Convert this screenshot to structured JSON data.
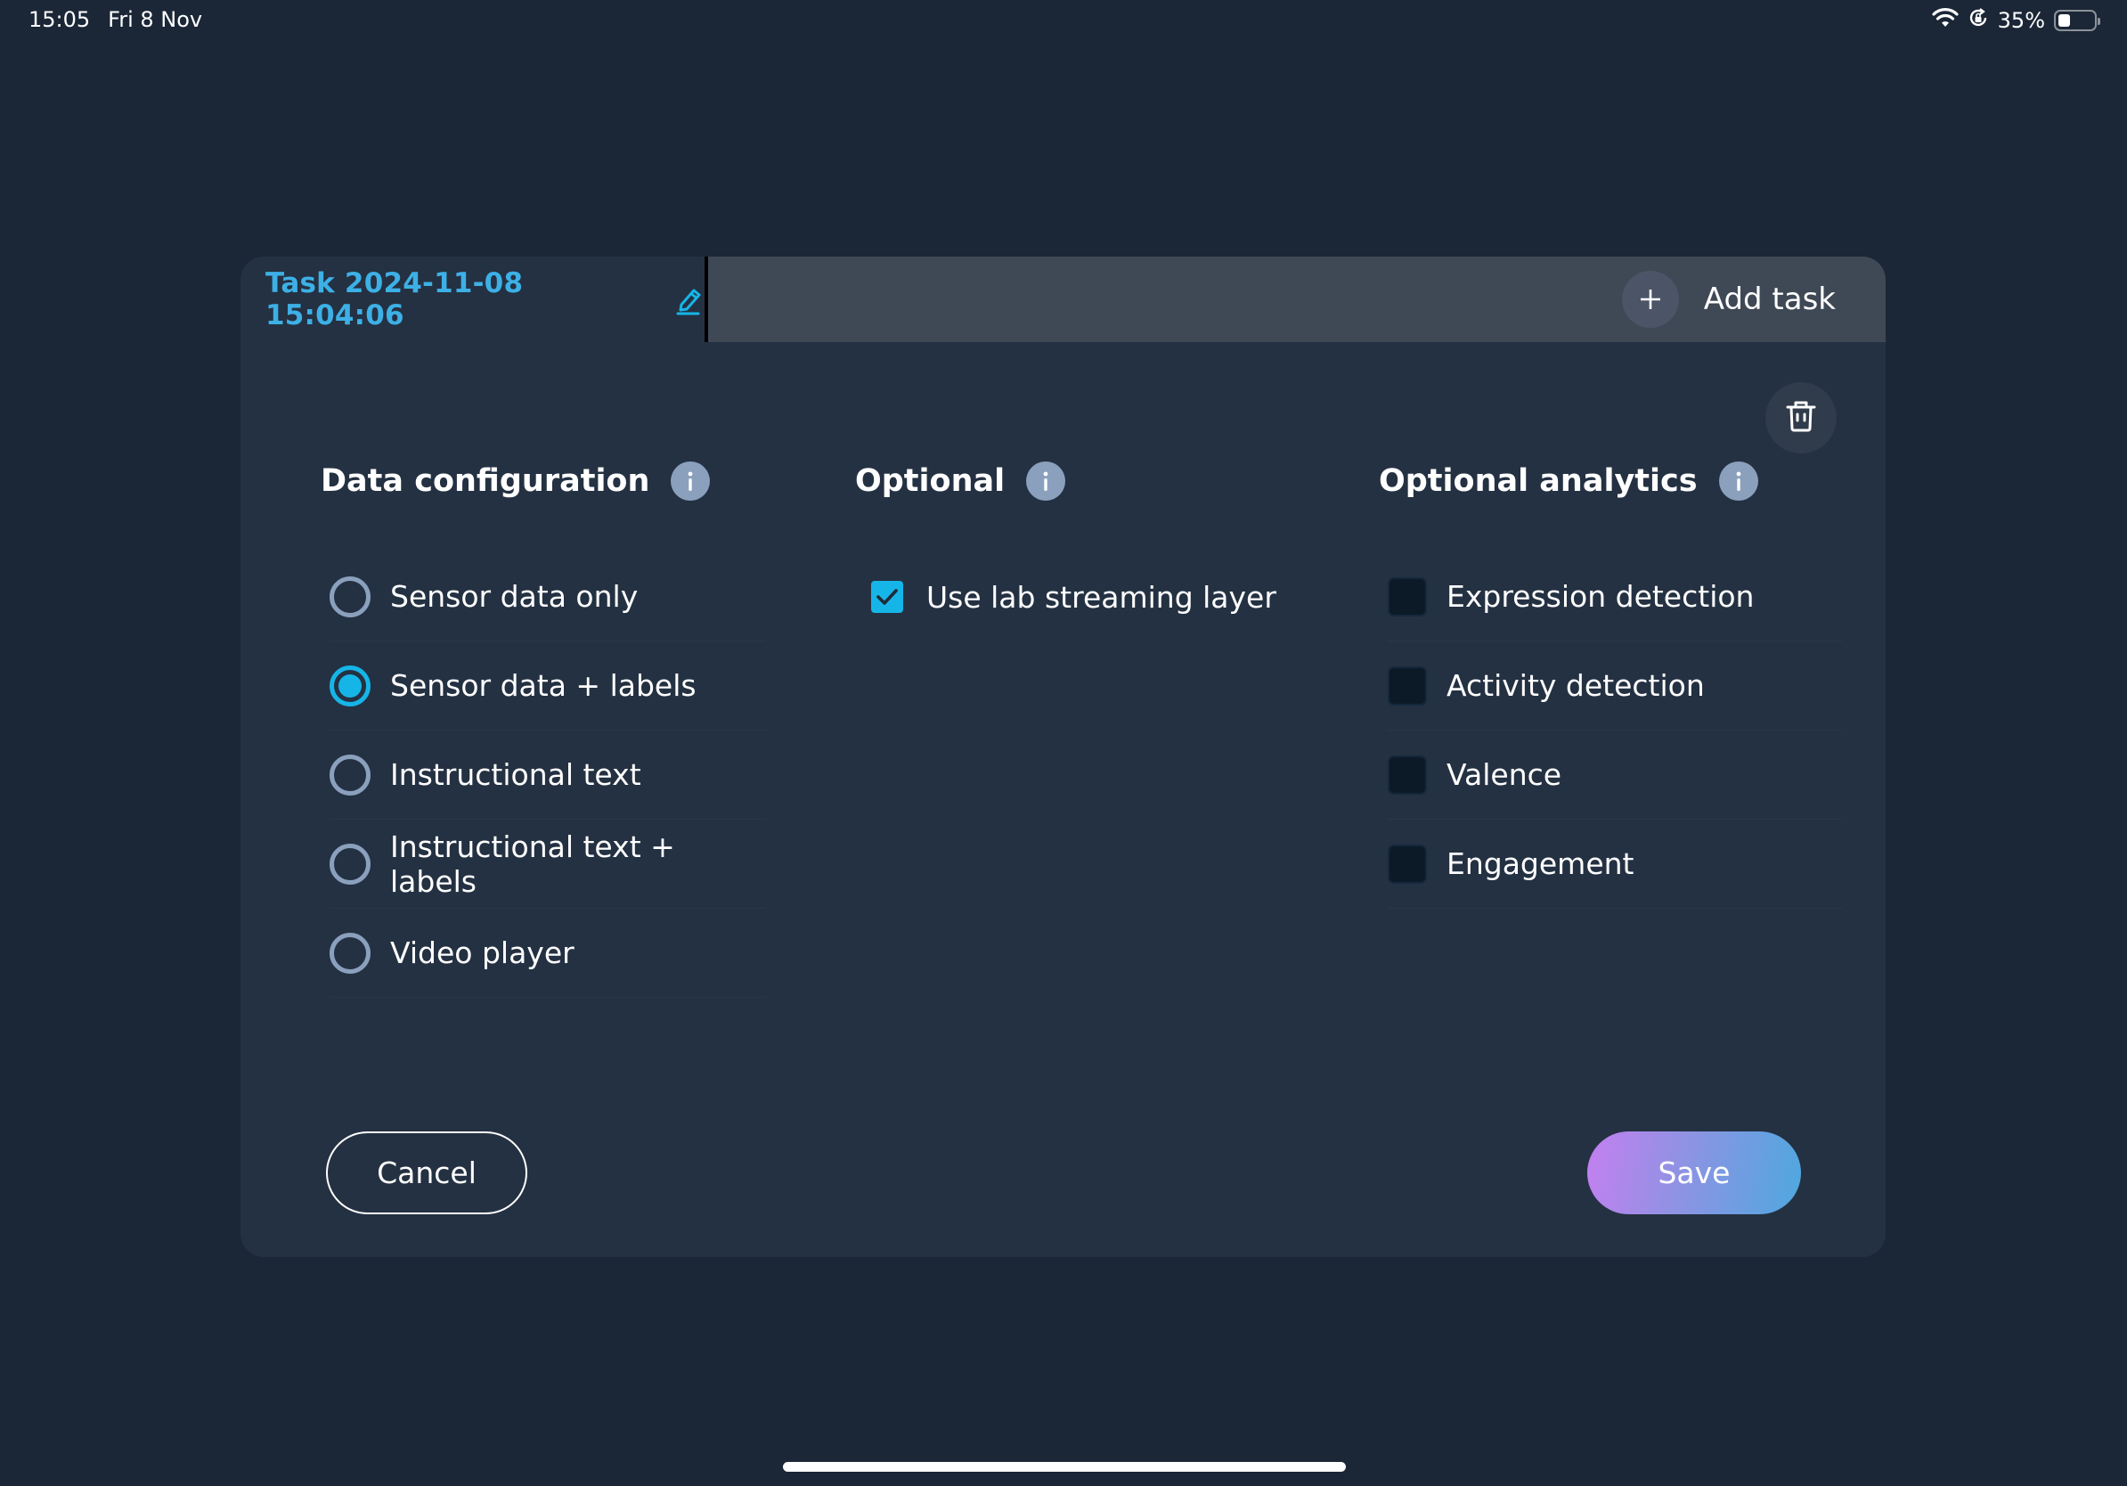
{
  "status_bar": {
    "time": "15:05",
    "date": "Fri 8 Nov",
    "battery_percent": "35%",
    "battery_level": 0.35,
    "icons": [
      "wifi-icon",
      "orientation-lock-icon",
      "battery-icon"
    ]
  },
  "tabs": {
    "active_title": "Task 2024-11-08 15:04:06",
    "edit_icon": "pencil-icon",
    "add_task_label": "Add task",
    "add_icon": "plus-icon"
  },
  "actions": {
    "delete_icon": "trash-icon"
  },
  "sections": {
    "data_configuration": {
      "title": "Data configuration",
      "type": "radio",
      "selected": "Sensor data + labels",
      "options": [
        {
          "label": "Sensor data only",
          "checked": false
        },
        {
          "label": "Sensor data + labels",
          "checked": true
        },
        {
          "label": "Instructional text",
          "checked": false
        },
        {
          "label": "Instructional text + labels",
          "checked": false
        },
        {
          "label": "Video player",
          "checked": false
        }
      ]
    },
    "optional": {
      "title": "Optional",
      "type": "checkbox",
      "options": [
        {
          "label": "Use lab streaming layer",
          "checked": true
        }
      ]
    },
    "optional_analytics": {
      "title": "Optional analytics",
      "type": "checkbox",
      "options": [
        {
          "label": "Expression detection",
          "checked": false
        },
        {
          "label": "Activity detection",
          "checked": false
        },
        {
          "label": "Valence",
          "checked": false
        },
        {
          "label": "Engagement",
          "checked": false
        }
      ]
    }
  },
  "footer": {
    "cancel_label": "Cancel",
    "save_label": "Save"
  },
  "colors": {
    "accent": "#16b5e8",
    "title_blue": "#3db0e6",
    "background": "#1b2636",
    "card": "#243142",
    "save_gradient_start": "#c47ff0",
    "save_gradient_end": "#4ea8df"
  }
}
